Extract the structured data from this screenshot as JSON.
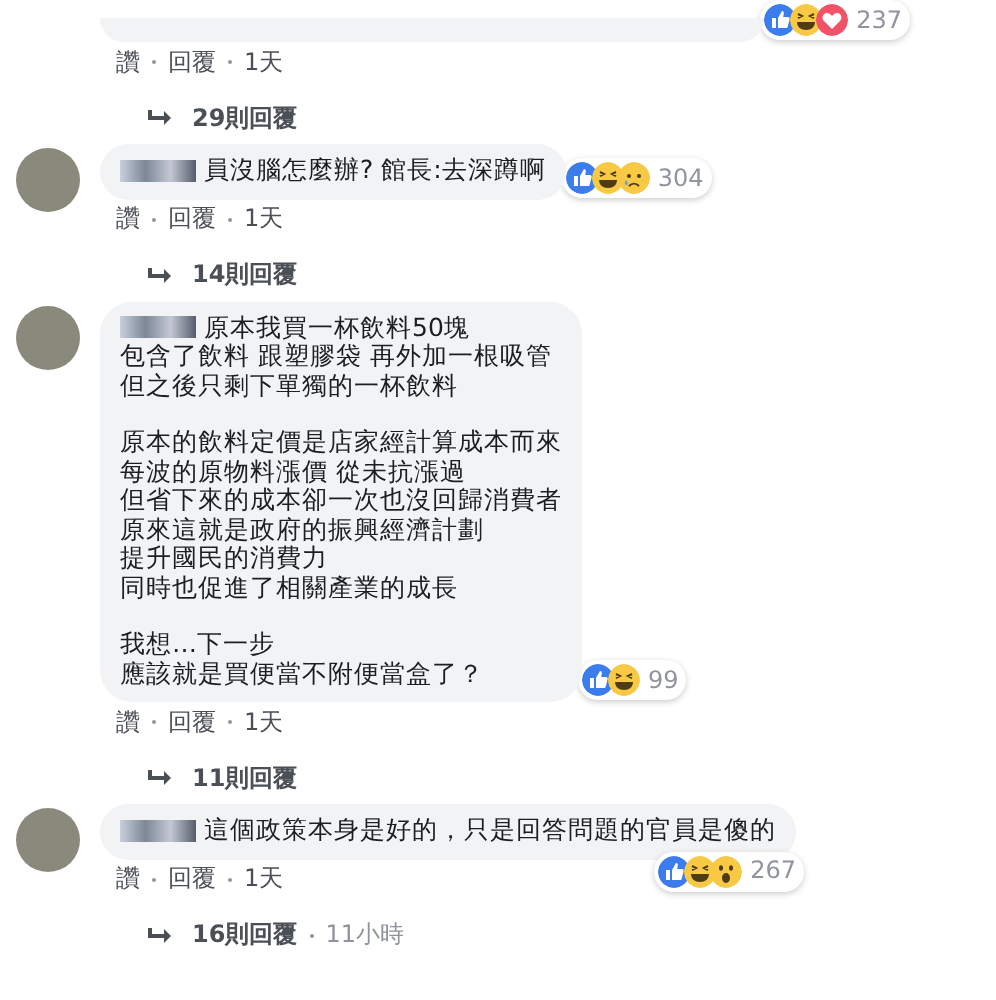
{
  "comments": [
    {
      "avatar": false,
      "reactions": {
        "icons": [
          {
            "kind": "like"
          },
          {
            "kind": "haha"
          },
          {
            "kind": "love"
          }
        ],
        "count": "237"
      },
      "actions": {
        "like": "讚",
        "reply": "回覆",
        "time": "1天"
      },
      "replies": {
        "label": "29則回覆"
      }
    },
    {
      "avatar": true,
      "paragraphs": [
        [
          "員沒腦怎麼辦? 館長:去深蹲啊"
        ]
      ],
      "reactions": {
        "icons": [
          {
            "kind": "like"
          },
          {
            "kind": "haha"
          },
          {
            "kind": "sad"
          }
        ],
        "count": "304"
      },
      "actions": {
        "like": "讚",
        "reply": "回覆",
        "time": "1天"
      },
      "replies": {
        "label": "14則回覆"
      }
    },
    {
      "avatar": true,
      "paragraphs": [
        [
          "原本我買一杯飲料50塊",
          "包含了飲料 跟塑膠袋 再外加一根吸管",
          "但之後只剩下單獨的一杯飲料"
        ],
        [
          "原本的飲料定價是店家經計算成本而來",
          "每波的原物料漲價 從未抗漲過",
          "但省下來的成本卻一次也沒回歸消費者",
          "原來這就是政府的振興經濟計劃",
          "提升國民的消費力",
          "同時也促進了相關產業的成長"
        ],
        [
          "我想…下一步",
          "應該就是買便當不附便當盒了？"
        ]
      ],
      "reactions": {
        "icons": [
          {
            "kind": "like"
          },
          {
            "kind": "haha"
          }
        ],
        "count": "99"
      },
      "actions": {
        "like": "讚",
        "reply": "回覆",
        "time": "1天"
      },
      "replies": {
        "label": "11則回覆"
      }
    },
    {
      "avatar": true,
      "paragraphs": [
        [
          "這個政策本身是好的，只是回答問題的官員是傻的"
        ]
      ],
      "reactions": {
        "icons": [
          {
            "kind": "like"
          },
          {
            "kind": "haha"
          },
          {
            "kind": "wow"
          }
        ],
        "count": "267"
      },
      "actions": {
        "like": "讚",
        "reply": "回覆",
        "time": "1天"
      },
      "replies": {
        "label": "16則回覆",
        "time": "11小時"
      }
    }
  ]
}
